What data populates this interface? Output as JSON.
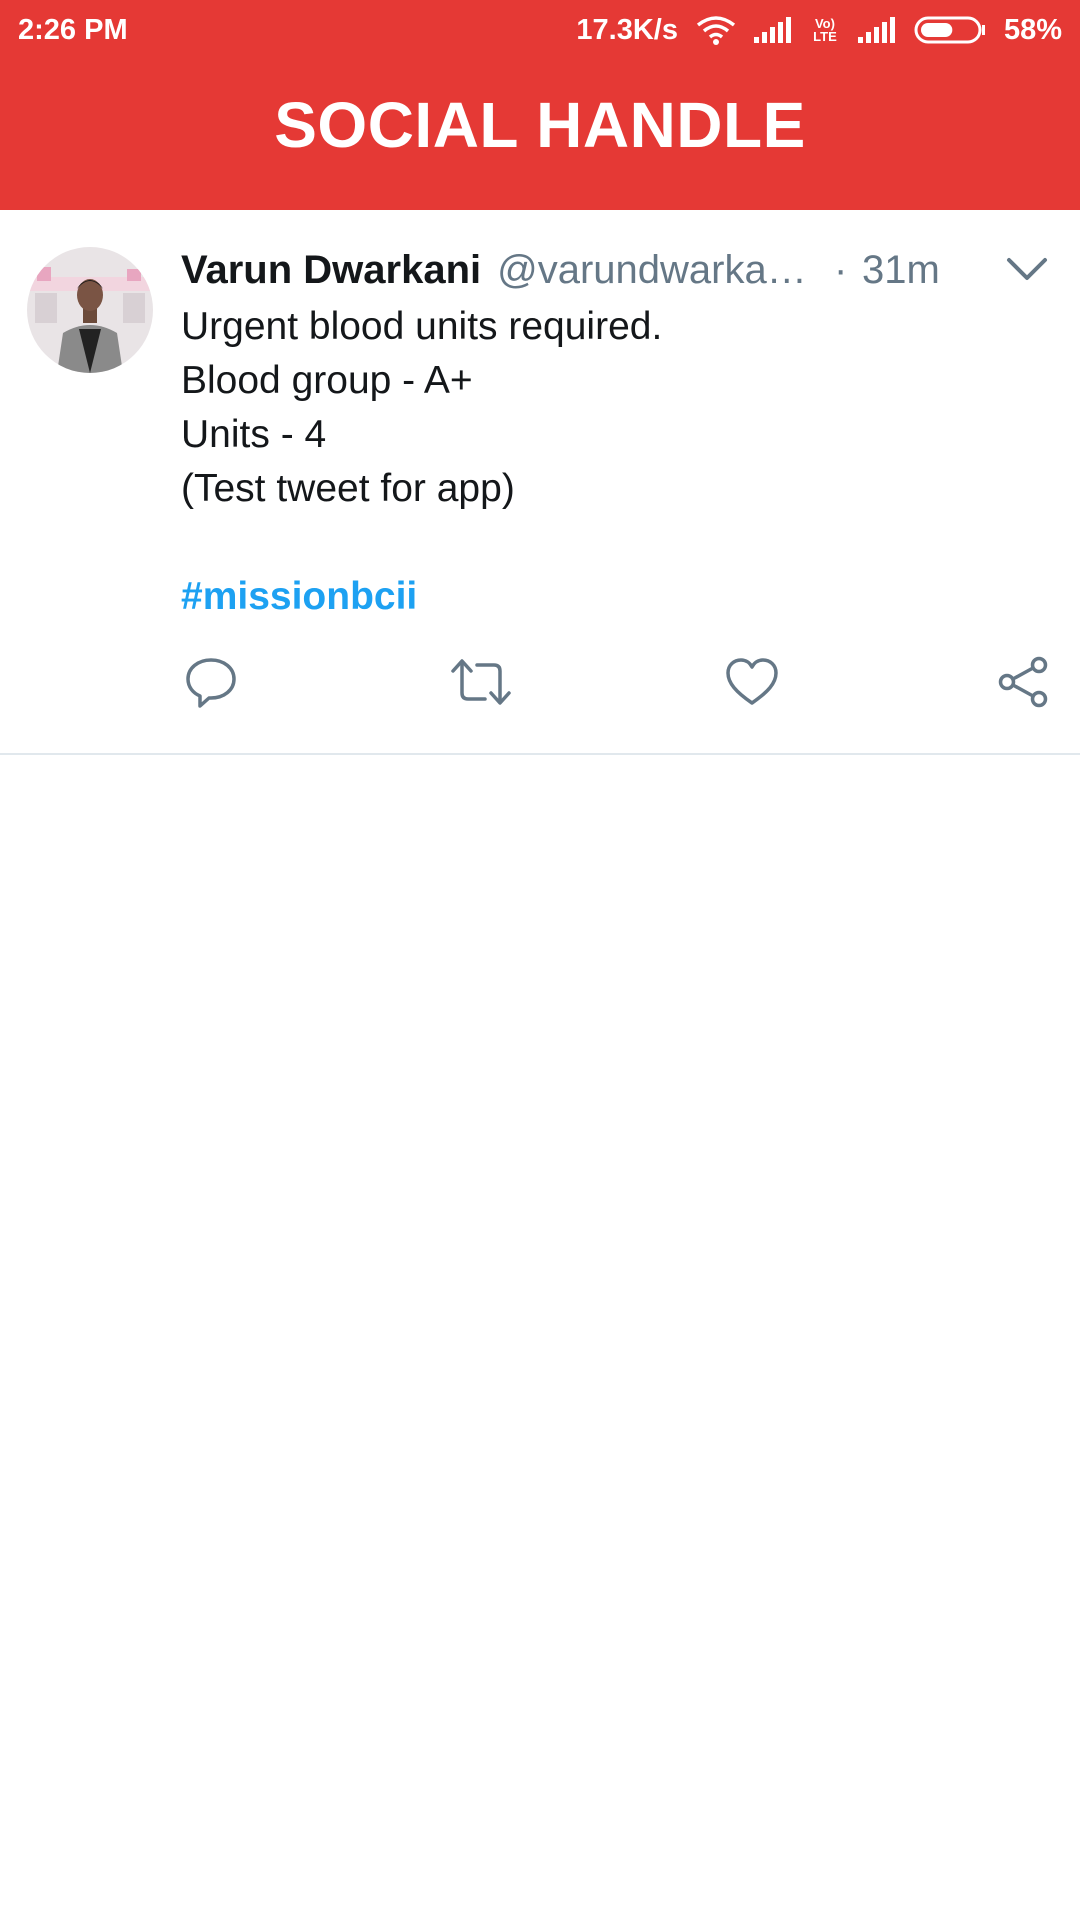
{
  "status_bar": {
    "time": "2:26 PM",
    "net_speed": "17.3K/s",
    "volte_label": "Vo) LTE",
    "battery_percent": "58%",
    "battery_level": 0.58
  },
  "app_bar": {
    "title": "SOCIAL HANDLE",
    "color": "#e53935"
  },
  "tweet": {
    "author_name": "Varun Dwarkani",
    "author_handle": "@varundwarka…",
    "dot": "·",
    "time": "31m",
    "lines": [
      "Urgent blood units required.",
      "Blood group - A+",
      "Units - 4",
      "(Test tweet for app)"
    ],
    "hashtag": "#missionbcii",
    "hashtag_color": "#1da1f2",
    "actions": [
      "reply-icon",
      "retweet-icon",
      "like-icon",
      "share-icon"
    ]
  }
}
